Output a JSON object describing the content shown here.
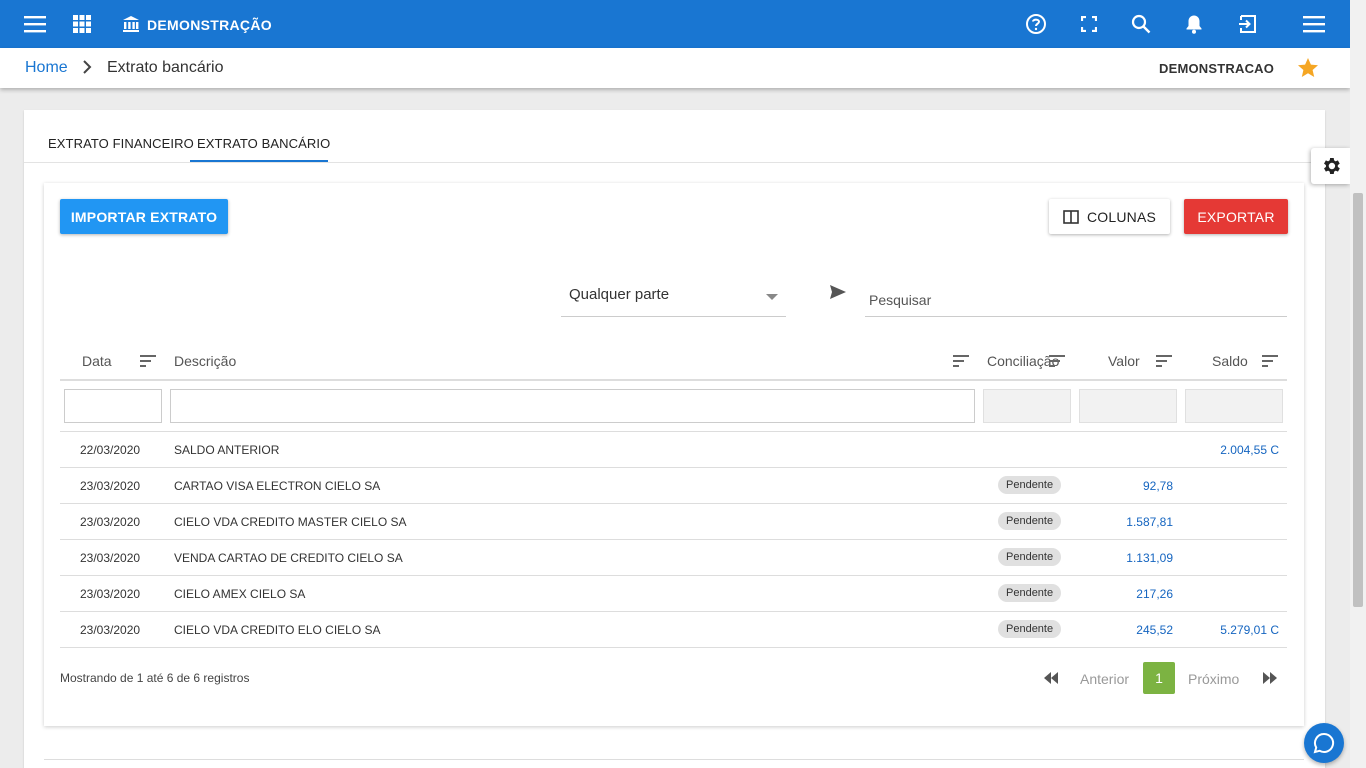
{
  "header": {
    "company": "DEMONSTRAÇÃO"
  },
  "breadcrumb": {
    "home": "Home",
    "current": "Extrato bancário",
    "company": "DEMONSTRACAO"
  },
  "tabs": [
    {
      "label": "EXTRATO FINANCEIRO"
    },
    {
      "label": "EXTRATO BANCÁRIO",
      "active": true
    }
  ],
  "toolbar": {
    "import_label": "IMPORTAR EXTRATO",
    "columns_label": "COLUNAS",
    "export_label": "EXPORTAR"
  },
  "filter": {
    "scope": "Qualquer parte",
    "search_placeholder": "Pesquisar"
  },
  "table": {
    "columns": [
      "Data",
      "Descrição",
      "Conciliação",
      "Valor",
      "Saldo"
    ],
    "rows": [
      {
        "date": "22/03/2020",
        "desc": "SALDO ANTERIOR",
        "status": "",
        "value": "",
        "balance": "2.004,55 C"
      },
      {
        "date": "23/03/2020",
        "desc": "CARTAO VISA ELECTRON CIELO SA",
        "status": "Pendente",
        "value": "92,78",
        "balance": ""
      },
      {
        "date": "23/03/2020",
        "desc": "CIELO VDA CREDITO MASTER CIELO SA",
        "status": "Pendente",
        "value": "1.587,81",
        "balance": ""
      },
      {
        "date": "23/03/2020",
        "desc": "VENDA CARTAO DE CREDITO CIELO SA",
        "status": "Pendente",
        "value": "1.131,09",
        "balance": ""
      },
      {
        "date": "23/03/2020",
        "desc": "CIELO AMEX CIELO SA",
        "status": "Pendente",
        "value": "217,26",
        "balance": ""
      },
      {
        "date": "23/03/2020",
        "desc": "CIELO VDA CREDITO ELO CIELO SA",
        "status": "Pendente",
        "value": "245,52",
        "balance": "5.279,01 C"
      }
    ]
  },
  "pagination": {
    "showing": "Mostrando de 1 até 6 de 6 registros",
    "prev": "Anterior",
    "page": "1",
    "next": "Próximo"
  },
  "colors": {
    "primary": "#1976d2",
    "import": "#2196f3",
    "export": "#e53935",
    "page_active": "#7cb342",
    "star": "#f5a623"
  }
}
